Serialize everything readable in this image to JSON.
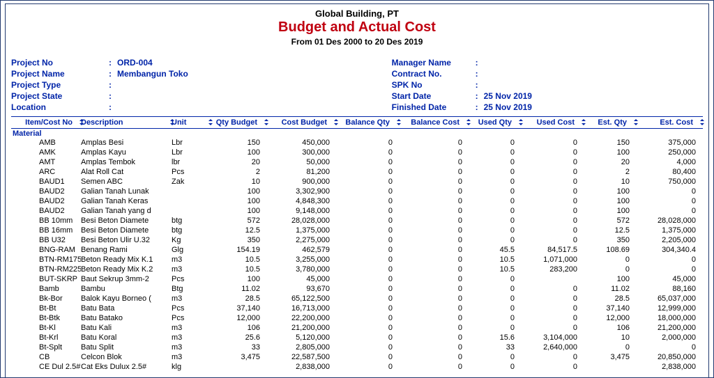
{
  "header": {
    "company": "Global Building, PT",
    "title": "Budget and Actual Cost",
    "range": "From 01 Des 2000 to 20 Des 2019"
  },
  "meta_left": {
    "project_no": {
      "label": "Project No",
      "value": "ORD-004"
    },
    "project_name": {
      "label": "Project Name",
      "value": "Membangun Toko"
    },
    "project_type": {
      "label": "Project Type",
      "value": ""
    },
    "project_state": {
      "label": "Project State",
      "value": ""
    },
    "location": {
      "label": "Location",
      "value": ""
    }
  },
  "meta_right": {
    "manager": {
      "label": "Manager Name",
      "value": ""
    },
    "contract": {
      "label": "Contract No.",
      "value": ""
    },
    "spk": {
      "label": "SPK No",
      "value": ""
    },
    "start": {
      "label": "Start Date",
      "value": "25 Nov 2019"
    },
    "finish": {
      "label": "Finished Date",
      "value": "25 Nov 2019"
    }
  },
  "columns": {
    "c1": "Item/Cost No",
    "c2": "Description",
    "c3": "Unit",
    "c4": "Qty Budget",
    "c5": "Cost Budget",
    "c6": "Balance Qty",
    "c7": "Balance Cost",
    "c8": "Used Qty",
    "c9": "Used Cost",
    "c10": "Est. Qty",
    "c11": "Est. Cost"
  },
  "section": "Material",
  "rows": [
    {
      "no": "AMB",
      "desc": "Amplas Besi",
      "unit": "Lbr",
      "qb": "150",
      "cb": "450,000",
      "bq": "0",
      "bc": "0",
      "uq": "0",
      "uc": "0",
      "eq": "150",
      "ec": "375,000"
    },
    {
      "no": "AMK",
      "desc": "Amplas Kayu",
      "unit": "Lbr",
      "qb": "100",
      "cb": "300,000",
      "bq": "0",
      "bc": "0",
      "uq": "0",
      "uc": "0",
      "eq": "100",
      "ec": "250,000"
    },
    {
      "no": "AMT",
      "desc": "Amplas Tembok",
      "unit": "lbr",
      "qb": "20",
      "cb": "50,000",
      "bq": "0",
      "bc": "0",
      "uq": "0",
      "uc": "0",
      "eq": "20",
      "ec": "4,000"
    },
    {
      "no": "ARC",
      "desc": "Alat Roll Cat",
      "unit": "Pcs",
      "qb": "2",
      "cb": "81,200",
      "bq": "0",
      "bc": "0",
      "uq": "0",
      "uc": "0",
      "eq": "2",
      "ec": "80,400"
    },
    {
      "no": "BAUD1",
      "desc": "Semen ABC",
      "unit": "Zak",
      "qb": "10",
      "cb": "900,000",
      "bq": "0",
      "bc": "0",
      "uq": "0",
      "uc": "0",
      "eq": "10",
      "ec": "750,000"
    },
    {
      "no": "BAUD2",
      "desc": "Galian Tanah Lunak",
      "unit": "",
      "qb": "100",
      "cb": "3,302,900",
      "bq": "0",
      "bc": "0",
      "uq": "0",
      "uc": "0",
      "eq": "100",
      "ec": "0"
    },
    {
      "no": "BAUD2",
      "desc": "Galian Tanah Keras",
      "unit": "",
      "qb": "100",
      "cb": "4,848,300",
      "bq": "0",
      "bc": "0",
      "uq": "0",
      "uc": "0",
      "eq": "100",
      "ec": "0"
    },
    {
      "no": "BAUD2",
      "desc": "Galian Tanah yang d",
      "unit": "",
      "qb": "100",
      "cb": "9,148,000",
      "bq": "0",
      "bc": "0",
      "uq": "0",
      "uc": "0",
      "eq": "100",
      "ec": "0"
    },
    {
      "no": "BB 10mm",
      "desc": "Besi Beton Diamete",
      "unit": "btg",
      "qb": "572",
      "cb": "28,028,000",
      "bq": "0",
      "bc": "0",
      "uq": "0",
      "uc": "0",
      "eq": "572",
      "ec": "28,028,000"
    },
    {
      "no": "BB 16mm",
      "desc": "Besi Beton Diamete",
      "unit": "btg",
      "qb": "12.5",
      "cb": "1,375,000",
      "bq": "0",
      "bc": "0",
      "uq": "0",
      "uc": "0",
      "eq": "12.5",
      "ec": "1,375,000"
    },
    {
      "no": "BB U32",
      "desc": "Besi Beton Ulir U.32",
      "unit": "Kg",
      "qb": "350",
      "cb": "2,275,000",
      "bq": "0",
      "bc": "0",
      "uq": "0",
      "uc": "0",
      "eq": "350",
      "ec": "2,205,000"
    },
    {
      "no": "BNG-RAM",
      "desc": "Benang Rami",
      "unit": "Glg",
      "qb": "154.19",
      "cb": "462,579",
      "bq": "0",
      "bc": "0",
      "uq": "45.5",
      "uc": "84,517.5",
      "eq": "108.69",
      "ec": "304,340.4"
    },
    {
      "no": "BTN-RM175",
      "desc": "Beton Ready Mix K.1",
      "unit": "m3",
      "qb": "10.5",
      "cb": "3,255,000",
      "bq": "0",
      "bc": "0",
      "uq": "10.5",
      "uc": "1,071,000",
      "eq": "0",
      "ec": "0"
    },
    {
      "no": "BTN-RM225",
      "desc": "Beton Ready Mix K.2",
      "unit": "m3",
      "qb": "10.5",
      "cb": "3,780,000",
      "bq": "0",
      "bc": "0",
      "uq": "10.5",
      "uc": "283,200",
      "eq": "0",
      "ec": "0"
    },
    {
      "no": "BUT-SKRP",
      "desc": "Baut Sekrup 3mm-2",
      "unit": "Pcs",
      "qb": "100",
      "cb": "45,000",
      "bq": "0",
      "bc": "0",
      "uq": "0",
      "uc": "",
      "eq": "100",
      "ec": "45,000"
    },
    {
      "no": "Bamb",
      "desc": "Bambu",
      "unit": "Btg",
      "qb": "11.02",
      "cb": "93,670",
      "bq": "0",
      "bc": "0",
      "uq": "0",
      "uc": "0",
      "eq": "11.02",
      "ec": "88,160"
    },
    {
      "no": "Bk-Bor",
      "desc": "Balok Kayu Borneo (",
      "unit": "m3",
      "qb": "28.5",
      "cb": "65,122,500",
      "bq": "0",
      "bc": "0",
      "uq": "0",
      "uc": "0",
      "eq": "28.5",
      "ec": "65,037,000"
    },
    {
      "no": "Bt-Bt",
      "desc": "Batu Bata",
      "unit": "Pcs",
      "qb": "37,140",
      "cb": "16,713,000",
      "bq": "0",
      "bc": "0",
      "uq": "0",
      "uc": "0",
      "eq": "37,140",
      "ec": "12,999,000"
    },
    {
      "no": "Bt-Btk",
      "desc": "Batu Batako",
      "unit": "Pcs",
      "qb": "12,000",
      "cb": "22,200,000",
      "bq": "0",
      "bc": "0",
      "uq": "0",
      "uc": "0",
      "eq": "12,000",
      "ec": "18,000,000"
    },
    {
      "no": "Bt-Kl",
      "desc": "Batu Kali",
      "unit": "m3",
      "qb": "106",
      "cb": "21,200,000",
      "bq": "0",
      "bc": "0",
      "uq": "0",
      "uc": "0",
      "eq": "106",
      "ec": "21,200,000"
    },
    {
      "no": "Bt-Krl",
      "desc": "Batu Koral",
      "unit": "m3",
      "qb": "25.6",
      "cb": "5,120,000",
      "bq": "0",
      "bc": "0",
      "uq": "15.6",
      "uc": "3,104,000",
      "eq": "10",
      "ec": "2,000,000"
    },
    {
      "no": "Bt-Splt",
      "desc": "Batu Split",
      "unit": "m3",
      "qb": "33",
      "cb": "2,805,000",
      "bq": "0",
      "bc": "0",
      "uq": "33",
      "uc": "2,640,000",
      "eq": "0",
      "ec": "0"
    },
    {
      "no": "CB",
      "desc": "Celcon Blok",
      "unit": "m3",
      "qb": "3,475",
      "cb": "22,587,500",
      "bq": "0",
      "bc": "0",
      "uq": "0",
      "uc": "0",
      "eq": "3,475",
      "ec": "20,850,000"
    },
    {
      "no": "CE Dul 2.5#",
      "desc": "Cat Eks Dulux 2.5#",
      "unit": "klg",
      "qb": "",
      "cb": "2,838,000",
      "bq": "0",
      "bc": "0",
      "uq": "0",
      "uc": "0",
      "eq": "",
      "ec": "2,838,000"
    }
  ]
}
